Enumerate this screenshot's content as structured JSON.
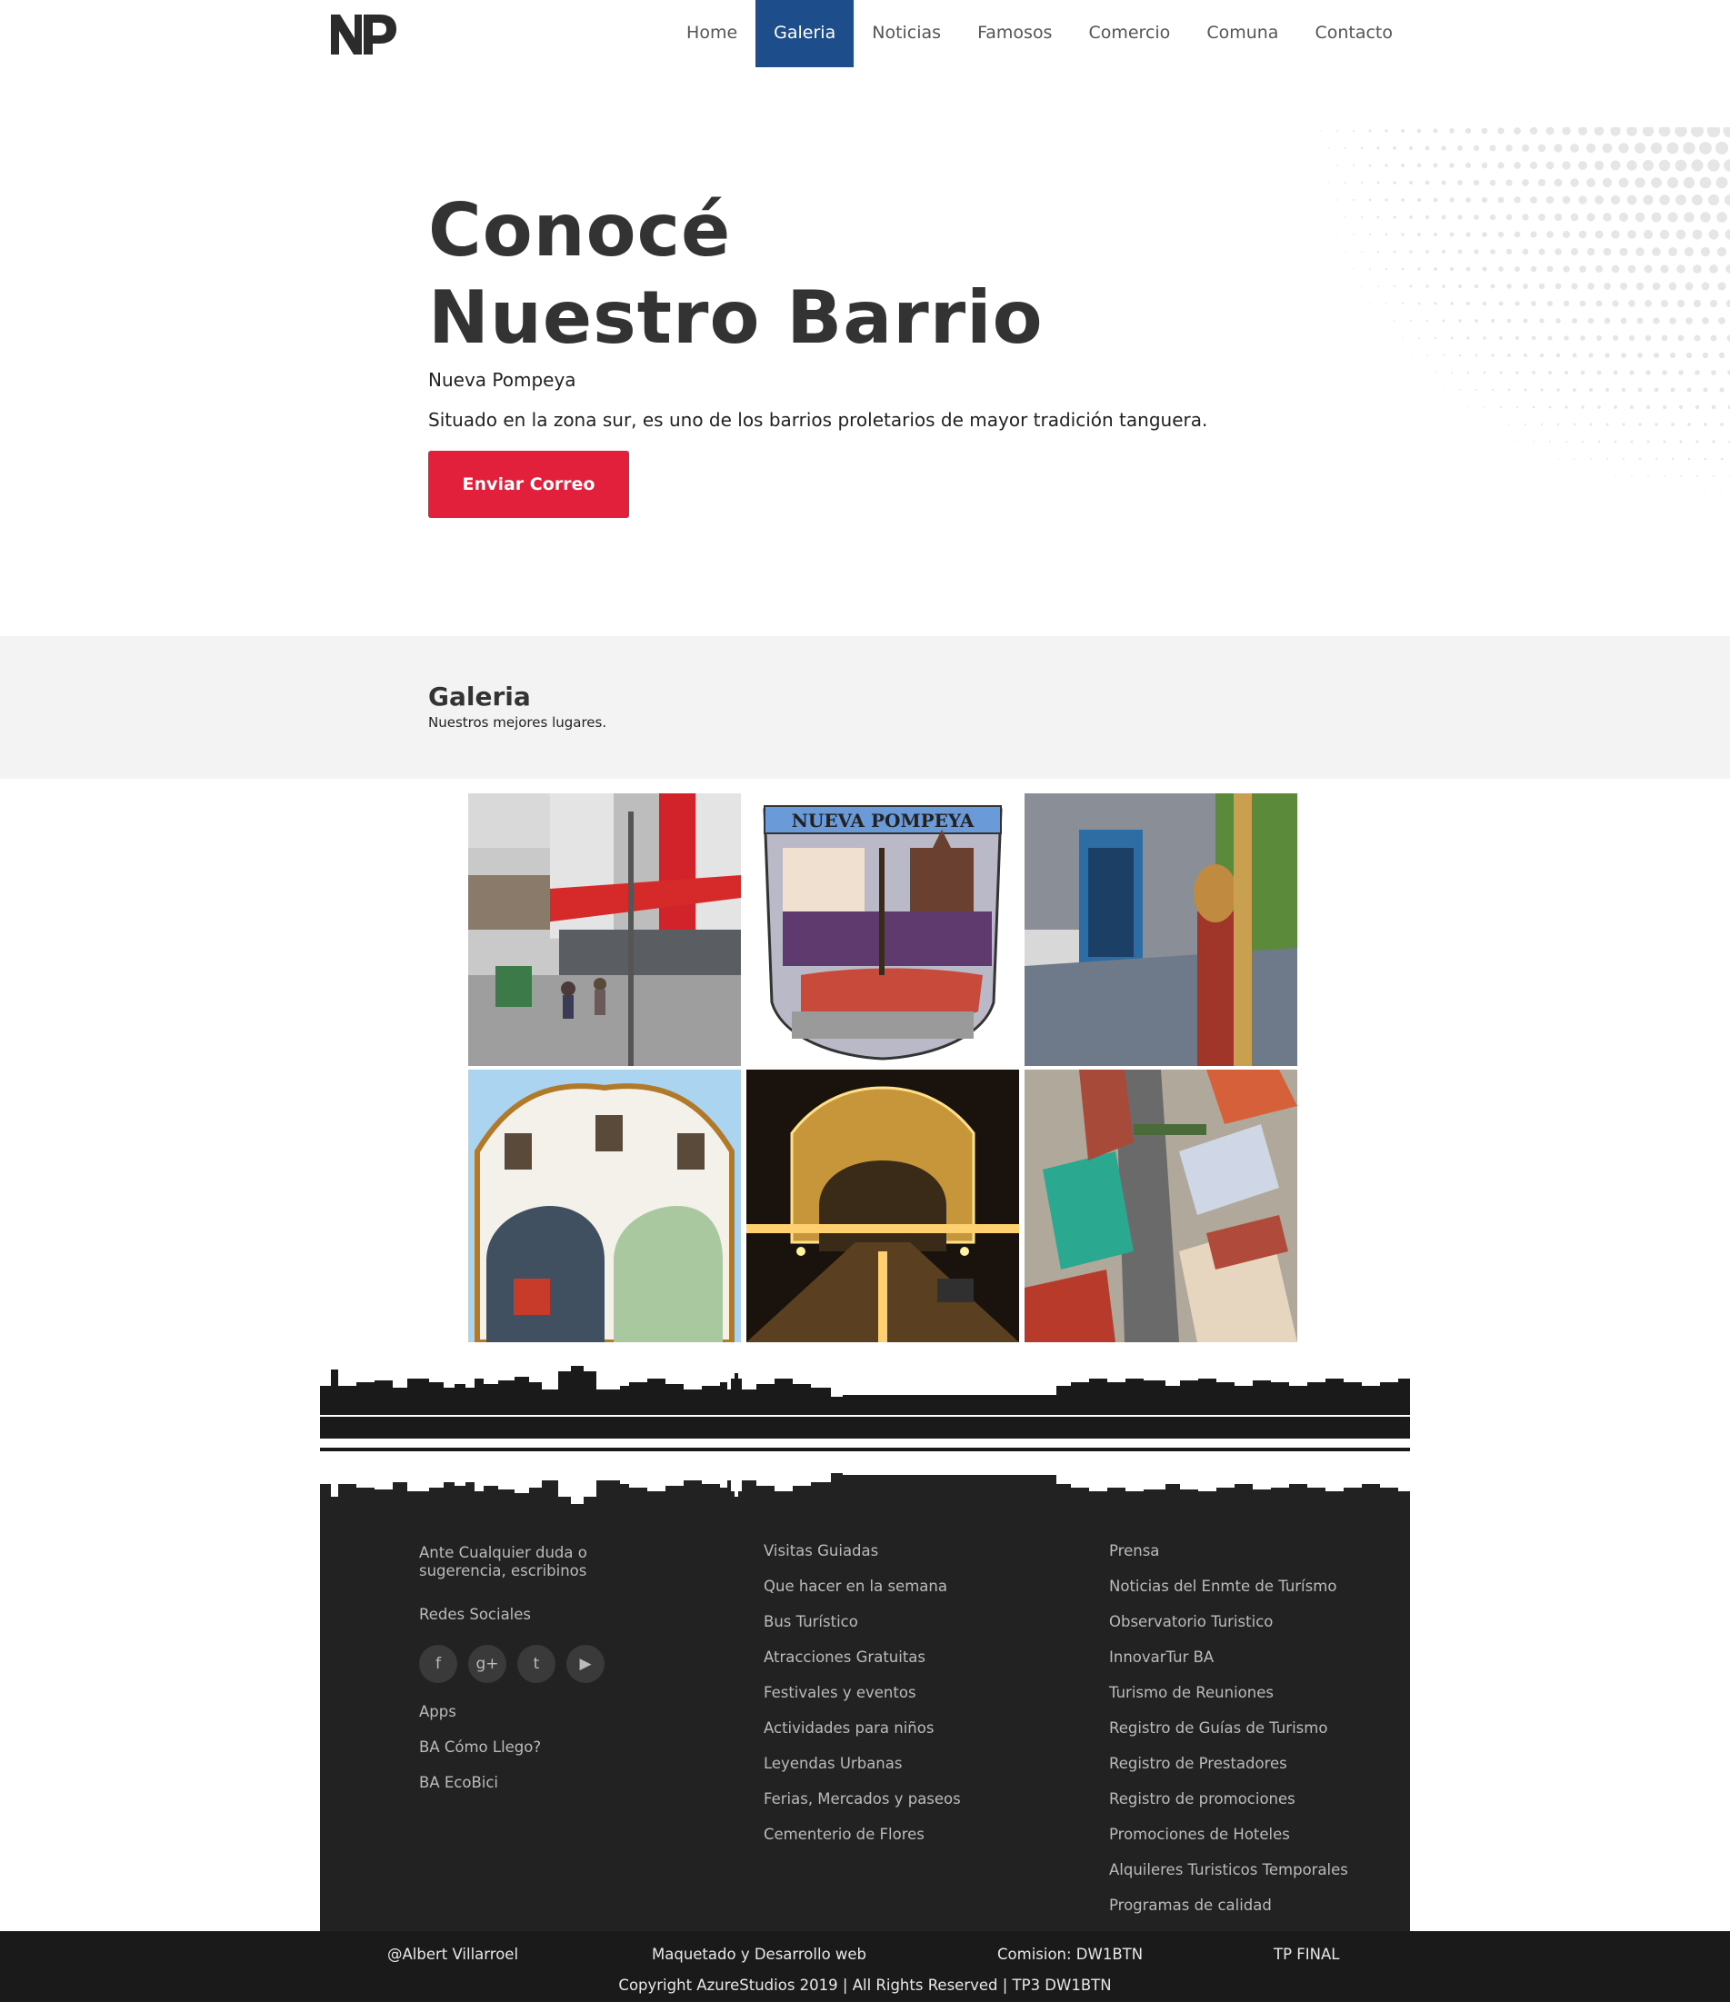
{
  "nav": {
    "logo_text": "NP",
    "items": [
      {
        "label": "Home",
        "active": false
      },
      {
        "label": "Galeria",
        "active": true
      },
      {
        "label": "Noticias",
        "active": false
      },
      {
        "label": "Famosos",
        "active": false
      },
      {
        "label": "Comercio",
        "active": false
      },
      {
        "label": "Comuna",
        "active": false
      },
      {
        "label": "Contacto",
        "active": false
      }
    ],
    "active_color": "#1e4d8c"
  },
  "hero": {
    "title_line1": "Conocé",
    "title_line2": "Nuestro Barrio",
    "subtitle": "Nueva Pompeya",
    "description": "Situado en la zona sur, es uno de los barrios proletarios de mayor tradición tanguera.",
    "button_label": "Enviar Correo",
    "button_color": "#e3203b"
  },
  "gallery": {
    "title": "Galeria",
    "subtitle": "Nuestros mejores lugares.",
    "escudo_text": "NUEVA POMPEYA",
    "tiles": [
      "street-photo",
      "escudo-image",
      "mural-photo",
      "bridge-day-photo",
      "bridge-night-photo",
      "aerial-rendering"
    ]
  },
  "footer": {
    "col1": {
      "contact_text": "Ante Cualquier duda o sugerencia, escribinos",
      "social_label": "Redes Sociales",
      "social_icons": [
        {
          "icon": "facebook-icon",
          "glyph": "f"
        },
        {
          "icon": "google-plus-icon",
          "glyph": "g+"
        },
        {
          "icon": "twitter-icon",
          "glyph": "t"
        },
        {
          "icon": "youtube-icon",
          "glyph": "▶"
        }
      ],
      "apps_label": "Apps",
      "apps": [
        "BA Cómo Llego?",
        "BA EcoBici"
      ]
    },
    "col2": [
      "Visitas Guiadas",
      "Que hacer en la semana",
      "Bus Turístico",
      "Atracciones Gratuitas",
      "Festivales y eventos",
      "Actividades para niños",
      "Leyendas Urbanas",
      "Ferias, Mercados y paseos",
      "Cementerio de Flores"
    ],
    "col3": [
      "Prensa",
      "Noticias del Enmte de Turísmo",
      "Observatorio Turistico",
      "InnovarTur BA",
      "Turismo de Reuniones",
      "Registro de Guías de Turismo",
      "Registro de Prestadores",
      "Registro de promociones",
      "Promociones de Hoteles",
      "Alquileres Turisticos Temporales",
      "Programas de calidad"
    ]
  },
  "bottom": {
    "author": "@Albert Villarroel",
    "role": "Maquetado y Desarrollo web",
    "commission": "Comision: DW1BTN",
    "project": "TP FINAL",
    "copyright": "Copyright AzureStudios 2019 | All Rights Reserved | TP3 DW1BTN"
  }
}
